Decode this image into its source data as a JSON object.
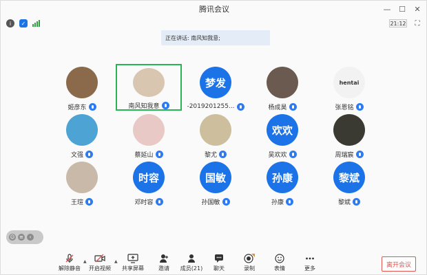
{
  "window": {
    "title": "腾讯会议",
    "controls": {
      "minimize": "—",
      "maximize": "☐",
      "close": "✕"
    }
  },
  "infobar": {
    "time": "21:12"
  },
  "banner": {
    "speaking": "正在讲话: 南风知我意;"
  },
  "participants": [
    {
      "name": "姬彦东",
      "avatar_type": "photo",
      "avatar_color": "#8a6a4b"
    },
    {
      "name": "南风知我意",
      "avatar_type": "photo",
      "avatar_color": "#d9c6b0",
      "active": true
    },
    {
      "name": "-2019201255...",
      "avatar_type": "text",
      "avatar_text": "梦发"
    },
    {
      "name": "杨成昊",
      "avatar_type": "photo",
      "avatar_color": "#6b5a4f"
    },
    {
      "name": "张恩铭",
      "avatar_type": "photo",
      "avatar_color": "#f2f2f2",
      "avatar_text": "hentai"
    },
    {
      "name": "文强",
      "avatar_type": "photo",
      "avatar_color": "#4da3d4"
    },
    {
      "name": "蔡延山",
      "avatar_type": "photo",
      "avatar_color": "#e9c9c5"
    },
    {
      "name": "黎尤",
      "avatar_type": "photo",
      "avatar_color": "#cdbf9e"
    },
    {
      "name": "吴欢欢",
      "avatar_type": "text",
      "avatar_text": "欢欢"
    },
    {
      "name": "周瑞宸",
      "avatar_type": "photo",
      "avatar_color": "#3a3a32"
    },
    {
      "name": "王瑄",
      "avatar_type": "photo",
      "avatar_color": "#c9b9a8"
    },
    {
      "name": "邓时容",
      "avatar_type": "text",
      "avatar_text": "时容"
    },
    {
      "name": "孙国敏",
      "avatar_type": "text",
      "avatar_text": "国敏"
    },
    {
      "name": "孙康",
      "avatar_type": "text",
      "avatar_text": "孙康"
    },
    {
      "name": "黎斌",
      "avatar_type": "text",
      "avatar_text": "黎斌"
    }
  ],
  "toolbar": {
    "unmute": "解除静音",
    "start_video": "开启视频",
    "share_screen": "共享屏幕",
    "invite": "邀请",
    "members": "成员(21)",
    "chat": "聊天",
    "record": "录制",
    "reactions": "表情",
    "more": "更多",
    "leave": "离开会议"
  },
  "colors": {
    "accent": "#1c73e8",
    "active_border": "#27b455",
    "leave": "#e0554f"
  }
}
